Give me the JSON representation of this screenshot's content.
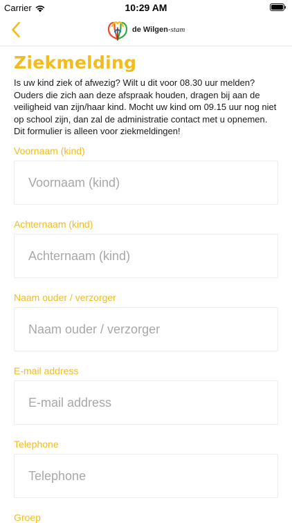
{
  "status_bar": {
    "carrier": "Carrier",
    "time": "10:29 AM"
  },
  "nav": {
    "back_icon": "chevron-left-icon",
    "logo_text_bold": "de Wilgen",
    "logo_text_script": "stam",
    "accent_color": "#f1bc1c"
  },
  "page": {
    "title": "Ziekmelding",
    "intro": "Is uw kind ziek of afwezig? Wilt u dit voor 08.30 uur melden? Ouders die zich aan deze afspraak houden, dragen bij aan de veiligheid van zijn/haar kind. Mocht uw kind om 09.15 uur nog niet op school zijn, dan zal de administratie contact met u opnemen. Dit formulier is alleen voor ziekmeldingen!"
  },
  "form": {
    "fields": [
      {
        "label": "Voornaam (kind)",
        "placeholder": "Voornaam (kind)",
        "value": ""
      },
      {
        "label": "Achternaam (kind)",
        "placeholder": "Achternaam (kind)",
        "value": ""
      },
      {
        "label": "Naam ouder / verzorger",
        "placeholder": "Naam ouder / verzorger",
        "value": ""
      },
      {
        "label": "E-mail address",
        "placeholder": "E-mail address",
        "value": ""
      },
      {
        "label": "Telephone",
        "placeholder": "Telephone",
        "value": ""
      },
      {
        "label": "Groep"
      }
    ]
  }
}
